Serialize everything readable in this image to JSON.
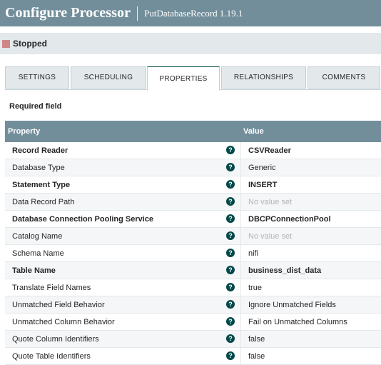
{
  "header": {
    "title": "Configure Processor",
    "subtitle": "PutDatabaseRecord 1.19.1"
  },
  "status": {
    "text": "Stopped",
    "color": "#d18686"
  },
  "tabs": [
    {
      "label": "SETTINGS",
      "active": false
    },
    {
      "label": "SCHEDULING",
      "active": false
    },
    {
      "label": "PROPERTIES",
      "active": true
    },
    {
      "label": "RELATIONSHIPS",
      "active": false
    },
    {
      "label": "COMMENTS",
      "active": false
    }
  ],
  "required_label": "Required field",
  "table": {
    "columns": [
      "Property",
      "Value"
    ],
    "rows": [
      {
        "name": "Record Reader",
        "value": "CSVReader",
        "required": true,
        "unset": false
      },
      {
        "name": "Database Type",
        "value": "Generic",
        "required": false,
        "unset": false
      },
      {
        "name": "Statement Type",
        "value": "INSERT",
        "required": true,
        "unset": false
      },
      {
        "name": "Data Record Path",
        "value": "No value set",
        "required": false,
        "unset": true
      },
      {
        "name": "Database Connection Pooling Service",
        "value": "DBCPConnectionPool",
        "required": true,
        "unset": false
      },
      {
        "name": "Catalog Name",
        "value": "No value set",
        "required": false,
        "unset": true
      },
      {
        "name": "Schema Name",
        "value": "nifi",
        "required": false,
        "unset": false
      },
      {
        "name": "Table Name",
        "value": "business_dist_data",
        "required": true,
        "unset": false
      },
      {
        "name": "Translate Field Names",
        "value": "true",
        "required": false,
        "unset": false
      },
      {
        "name": "Unmatched Field Behavior",
        "value": "Ignore Unmatched Fields",
        "required": false,
        "unset": false
      },
      {
        "name": "Unmatched Column Behavior",
        "value": "Fail on Unmatched Columns",
        "required": false,
        "unset": false
      },
      {
        "name": "Quote Column Identifiers",
        "value": "false",
        "required": false,
        "unset": false
      },
      {
        "name": "Quote Table Identifiers",
        "value": "false",
        "required": false,
        "unset": false
      }
    ],
    "help_icon": "question-circle-icon"
  },
  "colors": {
    "header_bg": "#728e9b",
    "accent": "#004849",
    "status_bar_bg": "#e3e8eb"
  }
}
